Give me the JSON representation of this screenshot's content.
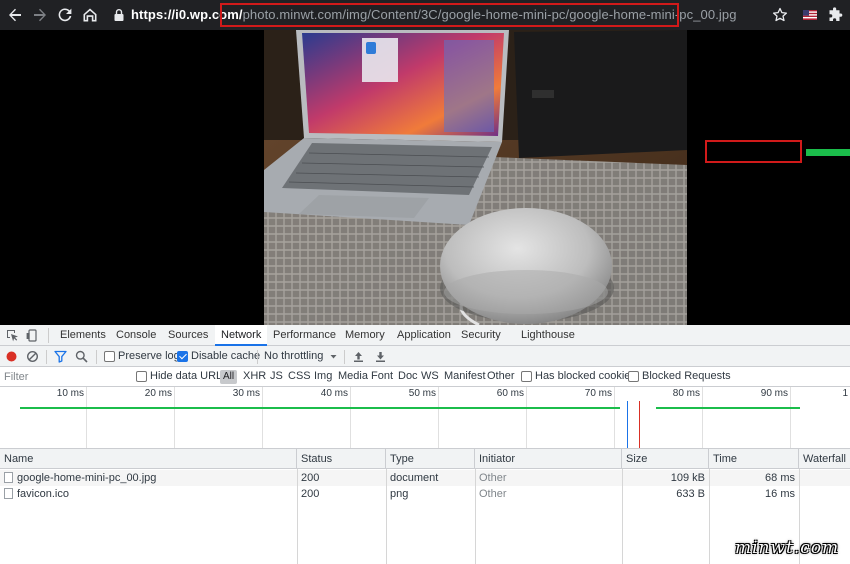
{
  "browser": {
    "url_host": "https://i0.wp.com/",
    "url_path": "photo.minwt.com/img/Content/3C/google-home-mini-pc/google-home-mini-pc_00.jpg",
    "icons": [
      "back-icon",
      "forward-icon",
      "reload-icon",
      "home-icon",
      "lock-icon",
      "star-icon",
      "flag-icon",
      "puzzle-icon"
    ]
  },
  "devtools": {
    "tabs": [
      {
        "label": "Elements"
      },
      {
        "label": "Console"
      },
      {
        "label": "Sources"
      },
      {
        "label": "Network",
        "active": true
      },
      {
        "label": "Performance"
      },
      {
        "label": "Memory"
      },
      {
        "label": "Application"
      },
      {
        "label": "Security"
      },
      {
        "label": "Lighthouse"
      }
    ],
    "toolbar": {
      "preserve_log": "Preserve log",
      "disable_cache": "Disable cache",
      "throttling": "No throttling"
    },
    "filter": {
      "placeholder": "Filter",
      "hide_data_urls": "Hide data URLs",
      "types": [
        "All",
        "XHR",
        "JS",
        "CSS",
        "Img",
        "Media",
        "Font",
        "Doc",
        "WS",
        "Manifest",
        "Other"
      ],
      "has_blocked_cookies": "Has blocked cookies",
      "blocked_requests": "Blocked Requests"
    },
    "overview_ticks": [
      "10 ms",
      "20 ms",
      "30 ms",
      "40 ms",
      "50 ms",
      "60 ms",
      "70 ms",
      "80 ms",
      "90 ms",
      "1"
    ],
    "columns": [
      "Name",
      "Status",
      "Type",
      "Initiator",
      "Size",
      "Time",
      "Waterfall"
    ],
    "rows": [
      {
        "name": "google-home-mini-pc_00.jpg",
        "status": "200",
        "type": "document",
        "initiator": "Other",
        "size": "109 kB",
        "time": "68 ms"
      },
      {
        "name": "favicon.ico",
        "status": "200",
        "type": "png",
        "initiator": "Other",
        "size": "633 B",
        "time": "16 ms"
      }
    ]
  },
  "watermark": "minwt.com",
  "colors": {
    "highlight": "#d11a1a",
    "active_tab": "#1a73e8",
    "record": "#d93025",
    "waterfall": "#1bbd4b"
  }
}
